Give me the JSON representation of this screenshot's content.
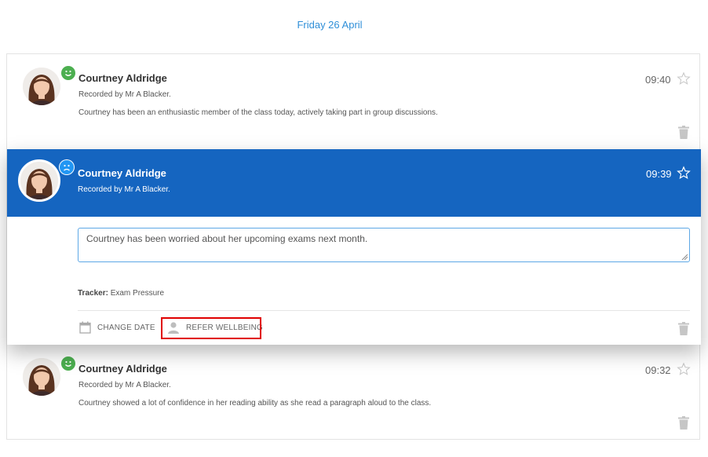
{
  "date_header": "Friday 26 April",
  "entries": [
    {
      "name": "Courtney Aldridge",
      "recorded_by": "Recorded by Mr A Blacker.",
      "comment": "Courtney has been an enthusiastic member of the class today, actively taking part in group discussions.",
      "time": "09:40",
      "mood": "happy"
    },
    {
      "name": "Courtney Aldridge",
      "recorded_by": "Recorded by Mr A Blacker.",
      "time": "09:39",
      "mood": "sad",
      "note_value": "Courtney has been worried about her upcoming exams next month.",
      "tracker_label": "Tracker:",
      "tracker_value": "Exam Pressure",
      "change_date_label": "CHANGE DATE",
      "refer_wellbeing_label": "REFER WELLBEING"
    },
    {
      "name": "Courtney Aldridge",
      "recorded_by": "Recorded by Mr A Blacker.",
      "comment": "Courtney showed a lot of confidence in her reading ability as she read a paragraph aloud to the class.",
      "time": "09:32",
      "mood": "happy"
    }
  ],
  "colors": {
    "accent_blue": "#1565c0",
    "date_blue": "#2f8fd8",
    "happy_green": "#4caf50",
    "sad_blue": "#2196f3",
    "highlight_red": "#e00000"
  }
}
